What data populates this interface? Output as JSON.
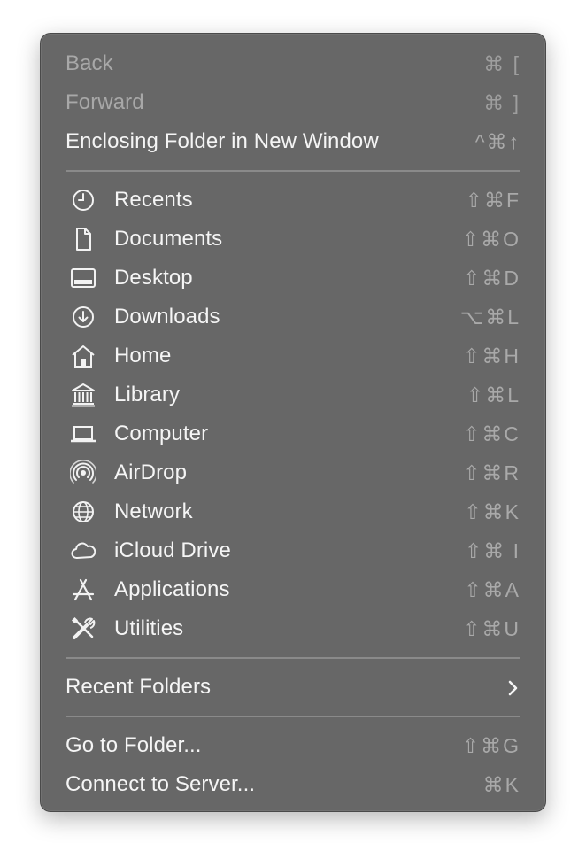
{
  "menu": {
    "top_items": [
      {
        "label": "Back",
        "shortcut": "⌘ [",
        "enabled": false
      },
      {
        "label": "Forward",
        "shortcut": "⌘ ]",
        "enabled": false
      },
      {
        "label": "Enclosing Folder in New Window",
        "shortcut": "^⌘↑",
        "enabled": true
      }
    ],
    "places": [
      {
        "label": "Recents",
        "shortcut": "⇧⌘F",
        "icon": "clock-icon"
      },
      {
        "label": "Documents",
        "shortcut": "⇧⌘O",
        "icon": "document-icon"
      },
      {
        "label": "Desktop",
        "shortcut": "⇧⌘D",
        "icon": "desktop-icon"
      },
      {
        "label": "Downloads",
        "shortcut": "⌥⌘L",
        "icon": "download-icon"
      },
      {
        "label": "Home",
        "shortcut": "⇧⌘H",
        "icon": "home-icon"
      },
      {
        "label": "Library",
        "shortcut": "⇧⌘L",
        "icon": "library-icon"
      },
      {
        "label": "Computer",
        "shortcut": "⇧⌘C",
        "icon": "laptop-icon"
      },
      {
        "label": "AirDrop",
        "shortcut": "⇧⌘R",
        "icon": "airdrop-icon"
      },
      {
        "label": "Network",
        "shortcut": "⇧⌘K",
        "icon": "globe-icon"
      },
      {
        "label": "iCloud Drive",
        "shortcut": "⇧⌘ I",
        "icon": "cloud-icon"
      },
      {
        "label": "Applications",
        "shortcut": "⇧⌘A",
        "icon": "applications-icon"
      },
      {
        "label": "Utilities",
        "shortcut": "⇧⌘U",
        "icon": "tools-icon"
      }
    ],
    "recent_folders": {
      "label": "Recent Folders",
      "icon": "chevron-right-icon"
    },
    "bottom_items": [
      {
        "label": "Go to Folder...",
        "shortcut": "⇧⌘G"
      },
      {
        "label": "Connect to Server...",
        "shortcut": "⌘K"
      }
    ]
  },
  "colors": {
    "menu_background": "#676767",
    "text": "#f5f5f5",
    "disabled_text": "#a8a8a8",
    "shortcut_text": "#a9a9a9",
    "separator": "#8a8a8a"
  }
}
